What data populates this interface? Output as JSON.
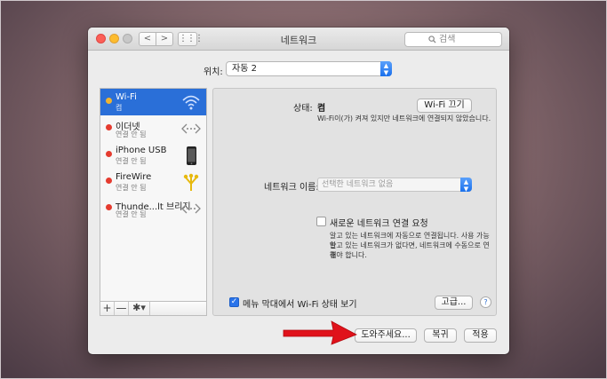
{
  "window": {
    "title": "네트워크"
  },
  "toolbar": {
    "back": "<",
    "forward": ">",
    "grid": "⋮⋮⋮",
    "search_placeholder": "검색"
  },
  "location": {
    "label": "위치:",
    "value": "자동 2"
  },
  "sidebar": {
    "items": [
      {
        "name": "Wi-Fi",
        "status": "켬",
        "icon": "wifi-icon",
        "status_color": "#f0b430",
        "selected": true
      },
      {
        "name": "이더넷",
        "status": "연결 안 됨",
        "icon": "ethernet-icon",
        "status_color": "#e53b2f",
        "selected": false
      },
      {
        "name": "iPhone USB",
        "status": "연결 안 됨",
        "icon": "iphone-icon",
        "status_color": "#e53b2f",
        "selected": false
      },
      {
        "name": "FireWire",
        "status": "연결 안 됨",
        "icon": "firewire-icon",
        "status_color": "#e53b2f",
        "selected": false
      },
      {
        "name": "Thunde...lt 브리지",
        "status": "연결 안 됨",
        "icon": "thunderbolt-bridge-icon",
        "status_color": "#e53b2f",
        "selected": false
      }
    ],
    "add": "+",
    "remove": "—",
    "gear": "✱▾"
  },
  "detail": {
    "status_label": "상태:",
    "status_value": "켬",
    "wifi_off_button": "Wi-Fi 끄기",
    "status_desc": "Wi-Fi이(가) 켜져 있지만 네트워크에 연결되지 않았습니다.",
    "network_name_label": "네트워크 이름:",
    "network_name_placeholder": "선택한 네트워크 없음",
    "ask_join_label": "새로운 네트워크 연결 요청",
    "ask_join_desc_1": "알고 있는 네트워크에 자동으로 연결됩니다. 사용 가능한",
    "ask_join_desc_2": "알고 있는 네트워크가 없다면, 네트워크에 수동으로 연결",
    "ask_join_desc_3": "해야 합니다.",
    "show_menu_label": "메뉴 막대에서 Wi-Fi 상태 보기",
    "show_menu_checked": true,
    "advanced_button": "고급...",
    "help": "?"
  },
  "footer": {
    "assist_button": "도와주세요...",
    "revert_button": "복귀",
    "apply_button": "적용"
  },
  "colors": {
    "accent": "#2a6fd8",
    "arrow": "#e0121b"
  }
}
